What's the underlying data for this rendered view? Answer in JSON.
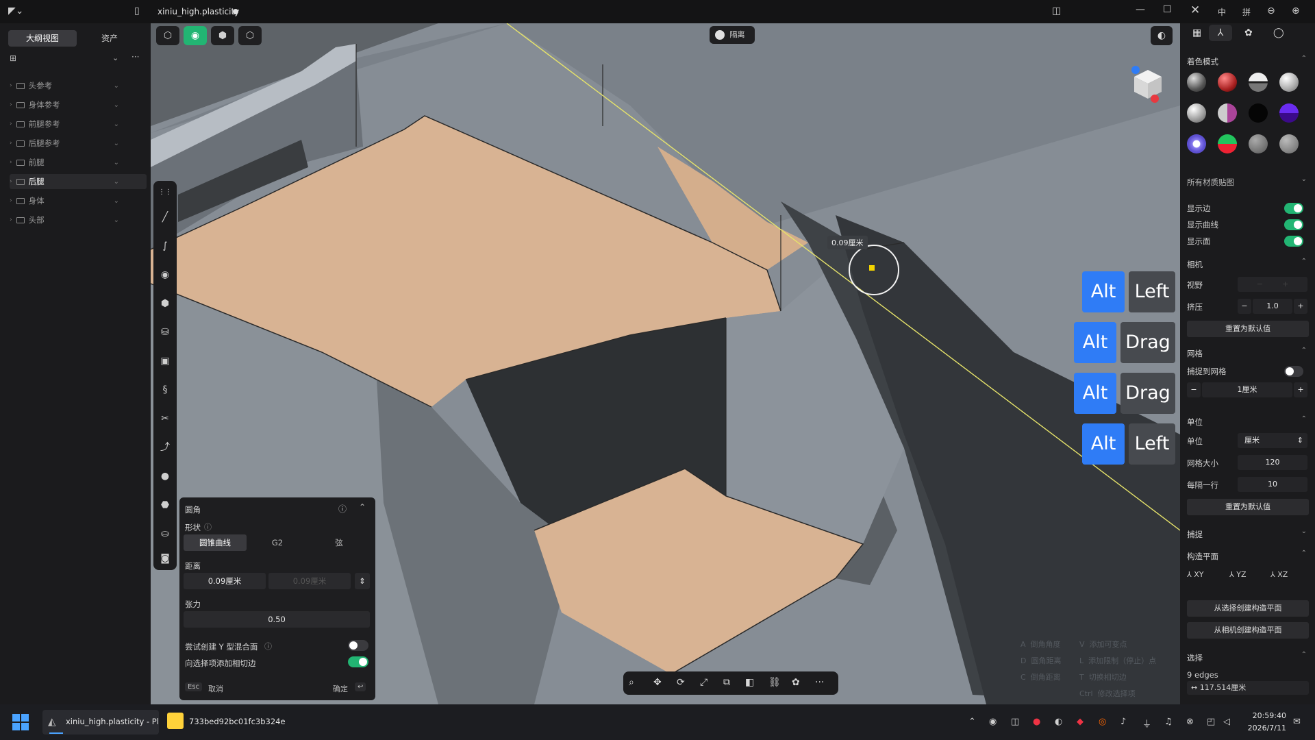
{
  "titlebar": {
    "file_name": "xiniu_high.plasticity",
    "lang_1": "中",
    "lang_2": "拼"
  },
  "left_panel": {
    "tabs": [
      "大纲视图",
      "资产"
    ],
    "items": [
      {
        "label": "头参考",
        "active": false
      },
      {
        "label": "身体参考",
        "active": false
      },
      {
        "label": "前腿参考",
        "active": false
      },
      {
        "label": "后腿参考",
        "active": false
      },
      {
        "label": "前腿",
        "active": false
      },
      {
        "label": "后腿",
        "active": true
      },
      {
        "label": "身体",
        "active": false
      },
      {
        "label": "头部",
        "active": false
      }
    ]
  },
  "viewport": {
    "isolate_label": "隔离",
    "dimension_tooltip": "0.09厘米"
  },
  "fillet_panel": {
    "title": "圆角",
    "shape_label": "形状",
    "shape_options": [
      "圆锥曲线",
      "G2",
      "弦"
    ],
    "shape_selected": 0,
    "distance_label": "距离",
    "distance_value": "0.09厘米",
    "distance_value_2": "0.09厘米",
    "tension_label": "张力",
    "tension_value": "0.50",
    "opt_y_blend": "尝试创建 Y 型混合面",
    "opt_y_blend_on": false,
    "opt_add_tangent": "向选择项添加相切边",
    "opt_add_tangent_on": true,
    "esc_key": "Esc",
    "cancel_label": "取消",
    "confirm_label": "确定"
  },
  "key_overlay": [
    {
      "mod": "Alt",
      "key": "Left"
    },
    {
      "mod": "Alt",
      "key": "Drag"
    },
    {
      "mod": "Alt",
      "key": "Drag"
    },
    {
      "mod": "Alt",
      "key": "Left"
    }
  ],
  "hints": {
    "col1": [
      {
        "key": "A",
        "label": "倒角角度"
      },
      {
        "key": "D",
        "label": "圆角距离"
      },
      {
        "key": "C",
        "label": "倒角距离"
      }
    ],
    "col2": [
      {
        "key": "V",
        "label": "添加可变点"
      },
      {
        "key": "L",
        "label": "添加限制（停止）点"
      },
      {
        "key": "T",
        "label": "切换相切边"
      },
      {
        "key": "Ctrl",
        "label": "修改选择项"
      }
    ]
  },
  "right_panel": {
    "shading_title": "着色模式",
    "all_materials": "所有材质贴图",
    "show_edges": "显示边",
    "show_curves": "显示曲线",
    "show_faces": "显示面",
    "camera_title": "相机",
    "fov_label": "视野",
    "squeeze_label": "挤压",
    "squeeze_value": "1.0",
    "reset_label": "重置为默认值",
    "grid_title": "网格",
    "snap_grid": "捕捉到网格",
    "grid_step": "1厘米",
    "units_title": "单位",
    "units_label": "单位",
    "units_value": "厘米",
    "grid_size_label": "网格大小",
    "grid_size_value": "120",
    "every_line_label": "每隔一行",
    "every_line_value": "10",
    "snap_title": "捕捉",
    "cplane_title": "构造平面",
    "cplanes": [
      "XY",
      "YZ",
      "XZ"
    ],
    "from_selection": "从选择创建构造平面",
    "from_camera": "从相机创建构造平面",
    "selection_title": "选择",
    "selection_count": "9 edges",
    "selection_length": "↔ 117.514厘米"
  },
  "taskbar": {
    "app1": "xiniu_high.plasticity - Pl",
    "app2": "733bed92bc01fc3b324e",
    "time": "20:59:40",
    "date": "2026/7/11"
  },
  "colors": {
    "accent": "#22b573",
    "key_blue": "#2f7cf6",
    "face_tan": "#d8b393",
    "wall_gray": "#7d858d"
  }
}
